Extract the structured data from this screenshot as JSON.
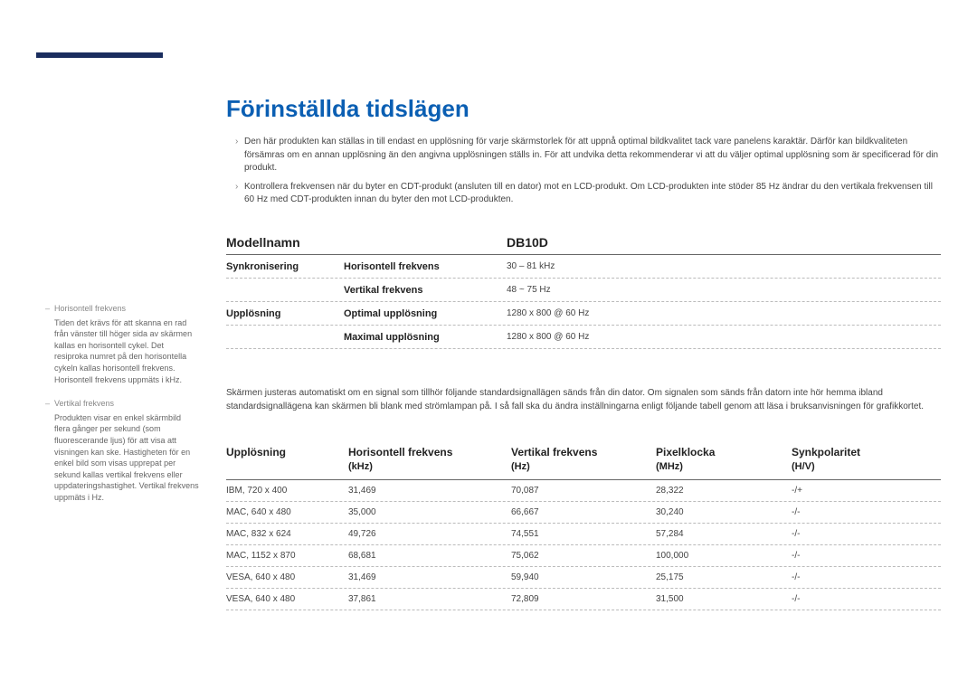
{
  "title": "Förinställda tidslägen",
  "notes": [
    "Den här produkten kan ställas in till endast en upplösning för varje skärmstorlek för att uppnå optimal bildkvalitet tack vare panelens karaktär. Därför kan bildkvaliteten försämras om en annan upplösning än den angivna upplösningen ställs in. För att undvika detta rekommenderar vi att du väljer optimal upplösning som är specificerad för din produkt.",
    "Kontrollera frekvensen när du byter en CDT-produkt (ansluten till en dator) mot en LCD-produkt. Om LCD-produkten inte stöder 85 Hz ändrar du den vertikala frekvensen till 60 Hz med CDT-produkten innan du byter den mot LCD-produkten."
  ],
  "sidebar": [
    {
      "title": "Horisontell frekvens",
      "body": "Tiden det krävs för att skanna en rad från vänster till höger sida av skärmen kallas en horisontell cykel. Det resiproka numret på den horisontella cykeln kallas horisontell frekvens. Horisontell frekvens uppmäts i kHz."
    },
    {
      "title": "Vertikal frekvens",
      "body": "Produkten visar en enkel skärmbild flera gånger per sekund (som fluorescerande ljus) för att visa att visningen kan ske. Hastigheten för en enkel bild som visas upprepat per sekund kallas vertikal frekvens eller uppdateringshastighet. Vertikal frekvens uppmäts i Hz."
    }
  ],
  "spec": {
    "modelLabel": "Modellnamn",
    "modelValue": "DB10D",
    "rows": [
      {
        "c1": "Synkronisering",
        "c2": "Horisontell frekvens",
        "c3": "30 – 81 kHz"
      },
      {
        "c1": "",
        "c2": "Vertikal frekvens",
        "c3": "48 ~ 75 Hz"
      },
      {
        "c1": "Upplösning",
        "c2": "Optimal upplösning",
        "c3": "1280 x 800 @ 60 Hz"
      },
      {
        "c1": "",
        "c2": "Maximal upplösning",
        "c3": "1280 x 800 @ 60 Hz"
      }
    ]
  },
  "desc": "Skärmen justeras automatiskt om en signal som tillhör följande standardsignallägen sänds från din dator. Om signalen som sänds från datorn inte hör hemma ibland standardsignallägena kan skärmen bli blank med strömlampan på. I så fall ska du ändra inställningarna enligt följande tabell genom att läsa i bruksanvisningen för grafikkortet.",
  "headers": {
    "c1": "Upplösning",
    "c2a": "Horisontell frekvens",
    "c2b": "(kHz)",
    "c3a": "Vertikal frekvens",
    "c3b": "(Hz)",
    "c4a": "Pixelklocka",
    "c4b": "(MHz)",
    "c5a": "Synkpolaritet",
    "c5b": "(H/V)"
  },
  "rows": [
    {
      "c1": "IBM, 720 x 400",
      "c2": "31,469",
      "c3": "70,087",
      "c4": "28,322",
      "c5": "-/+"
    },
    {
      "c1": "MAC, 640 x 480",
      "c2": "35,000",
      "c3": "66,667",
      "c4": "30,240",
      "c5": "-/-"
    },
    {
      "c1": "MAC, 832 x 624",
      "c2": "49,726",
      "c3": "74,551",
      "c4": "57,284",
      "c5": "-/-"
    },
    {
      "c1": "MAC, 1152 x 870",
      "c2": "68,681",
      "c3": "75,062",
      "c4": "100,000",
      "c5": "-/-"
    },
    {
      "c1": "VESA, 640 x 480",
      "c2": "31,469",
      "c3": "59,940",
      "c4": "25,175",
      "c5": "-/-"
    },
    {
      "c1": "VESA, 640 x 480",
      "c2": "37,861",
      "c3": "72,809",
      "c4": "31,500",
      "c5": "-/-"
    }
  ]
}
